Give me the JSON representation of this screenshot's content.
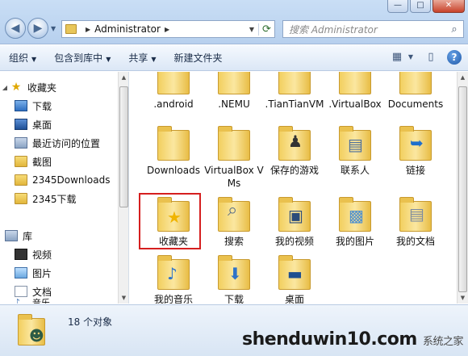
{
  "window": {
    "minimize": "—",
    "maximize": "□",
    "close": "✕"
  },
  "address": {
    "path": "Administrator",
    "search_placeholder": "搜索 Administrator"
  },
  "toolbar": {
    "organize": "组织",
    "include_in_library": "包含到库中",
    "share": "共享",
    "new_folder": "新建文件夹"
  },
  "sidebar": {
    "favorites": "收藏夹",
    "items": [
      "下载",
      "桌面",
      "最近访问的位置",
      "截图",
      "2345Downloads",
      "2345下载"
    ],
    "library": "库",
    "library_items": [
      "视频",
      "图片",
      "文档",
      "音乐"
    ]
  },
  "files": [
    {
      "name": ".android",
      "kind": "folder"
    },
    {
      "name": ".NEMU",
      "kind": "folder"
    },
    {
      "name": ".TianTianVM",
      "kind": "folder"
    },
    {
      "name": ".VirtualBox",
      "kind": "folder"
    },
    {
      "name": "Documents",
      "kind": "folder"
    },
    {
      "name": "Downloads",
      "kind": "folder"
    },
    {
      "name": "VirtualBox VMs",
      "kind": "folder"
    },
    {
      "name": "保存的游戏",
      "kind": "saved-games"
    },
    {
      "name": "联系人",
      "kind": "contacts"
    },
    {
      "name": "链接",
      "kind": "links"
    },
    {
      "name": "收藏夹",
      "kind": "favorites",
      "selected": true
    },
    {
      "name": "搜索",
      "kind": "searches"
    },
    {
      "name": "我的视频",
      "kind": "videos"
    },
    {
      "name": "我的图片",
      "kind": "pictures"
    },
    {
      "name": "我的文档",
      "kind": "documents"
    },
    {
      "name": "我的音乐",
      "kind": "music"
    },
    {
      "name": "下载",
      "kind": "downloads"
    },
    {
      "name": "桌面",
      "kind": "desktop"
    }
  ],
  "details": {
    "count": "18 个对象"
  },
  "watermark": {
    "text": "shenduwin10.com",
    "subtext": "系统之家"
  },
  "colors": {
    "selection_outline": "#d51f1f",
    "folder": "#f2cf5f"
  }
}
